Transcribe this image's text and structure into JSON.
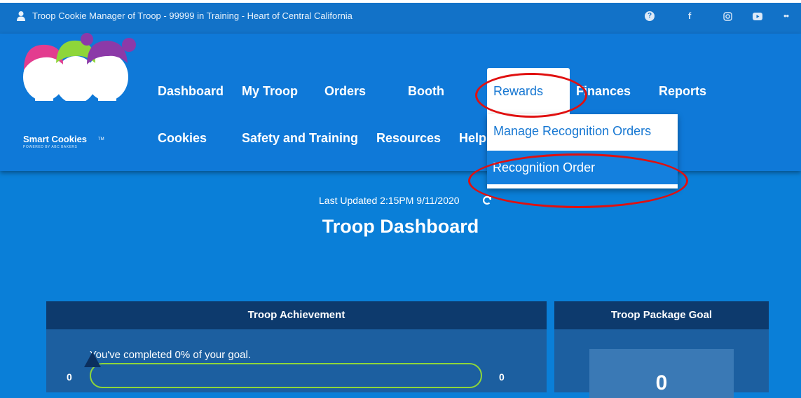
{
  "topbar": {
    "title": "Troop Cookie Manager of Troop - 99999 in Training - Heart of Central California",
    "icons": [
      "user-icon",
      "help-icon",
      "facebook-icon",
      "instagram-icon",
      "youtube-icon",
      "more-icon"
    ],
    "help_glyph": "?",
    "facebook_glyph": "f",
    "more_glyph": "••"
  },
  "logo": {
    "brand": "Smart Cookies",
    "tm": "TM",
    "tagline": "POWERED BY ABC BAKERS"
  },
  "nav": {
    "row1": [
      "Dashboard",
      "My Troop",
      "Orders",
      "Booth",
      "Rewards",
      "Finances",
      "Reports"
    ],
    "row2": [
      "Cookies",
      "Safety and Training",
      "Resources",
      "Help"
    ]
  },
  "rewards_menu": {
    "items": [
      "Manage Recognition Orders",
      "Recognition Order"
    ]
  },
  "main": {
    "last_updated": "Last Updated 2:15PM 9/11/2020",
    "title": "Troop Dashboard"
  },
  "achievement": {
    "title": "Troop Achievement",
    "message": "You've completed 0% of your goal.",
    "min": "0",
    "max": "0",
    "progress_percent": 0
  },
  "package_goal": {
    "title": "Troop Package Goal",
    "value": "0"
  },
  "colors": {
    "accent": "#0f79d8",
    "card_header": "#0d3a6d",
    "progress": "#8ed63a",
    "highlight": "#e01010"
  }
}
